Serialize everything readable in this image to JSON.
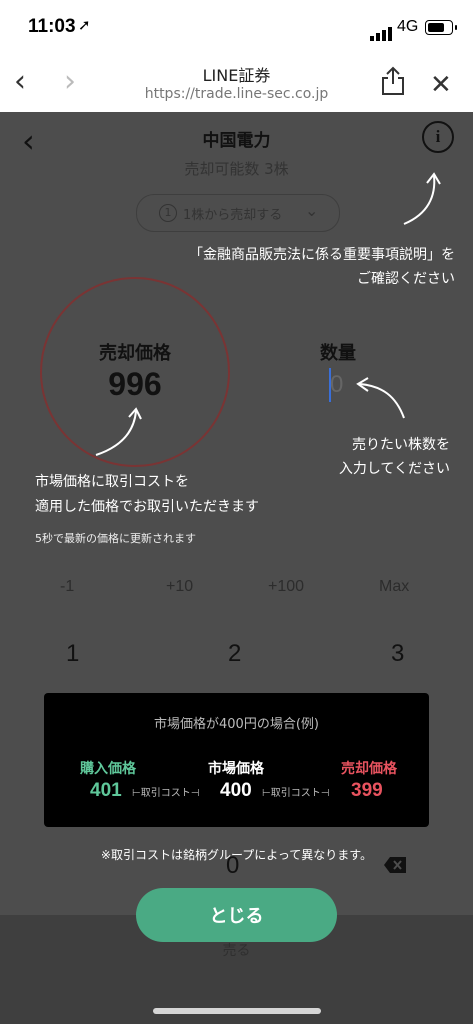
{
  "status_bar": {
    "time": "11:03",
    "location_icon": "location-arrow-icon",
    "network": "4G"
  },
  "browser": {
    "title": "LINE証券",
    "url": "https://trade.line-sec.co.jp"
  },
  "header": {
    "stock_name": "中国電力",
    "sellable": "売却可能数 3株",
    "unit_option": "1株から売却する",
    "unit_number": "1"
  },
  "tips": {
    "important_note_line1": "「金融商品販売法に係る重要事項説明」を",
    "important_note_line2": "ご確認ください",
    "qty_note_line1": "売りたい株数を",
    "qty_note_line2": "入力してください",
    "market_note_line1": "市場価格に取引コストを",
    "market_note_line2": "適用した価格でお取引いただきます"
  },
  "price": {
    "label": "売却価格",
    "value": "996"
  },
  "quantity": {
    "label": "数量",
    "value": "0"
  },
  "refresh_note": "5秒で最新の価格に更新されます",
  "quick_buttons": [
    "-1",
    "+10",
    "+100",
    "Max"
  ],
  "keypad": [
    "1",
    "2",
    "3",
    "0"
  ],
  "example": {
    "title": "市場価格が400円の場合(例)",
    "buy_label": "購入価格",
    "buy_value": "401",
    "market_label": "市場価格",
    "market_value": "400",
    "sell_label": "売却価格",
    "sell_value": "399",
    "cost_left": "⊢取引コスト⊣",
    "cost_right": "⊢取引コスト⊣",
    "buy_color": "#5fc79a",
    "sell_color": "#e8535f"
  },
  "cost_note": "※取引コストは銘柄グループによって異なります。",
  "hidden_button": "売る",
  "close_button": "とじる"
}
